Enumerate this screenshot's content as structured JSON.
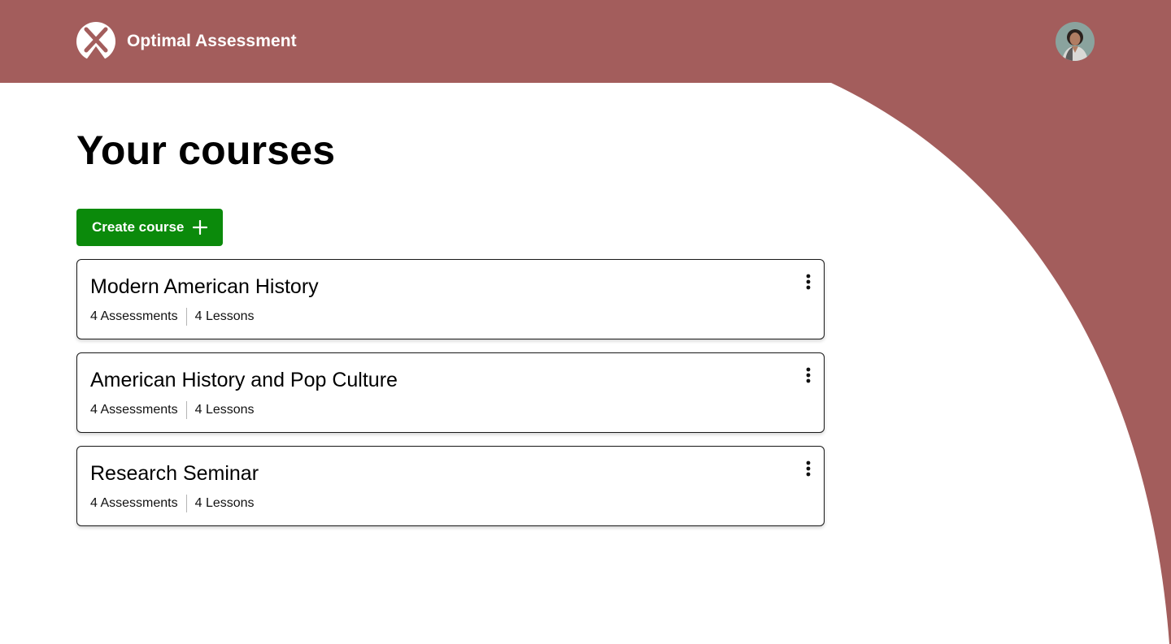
{
  "app": {
    "name": "Optimal Assessment"
  },
  "colors": {
    "brand": "#a35d5c",
    "accent_button": "#0b8a0b",
    "background": "#ffffff"
  },
  "header": {
    "logo_icon": "crossed-pencils-logo-icon",
    "avatar_icon": "user-avatar"
  },
  "main": {
    "title": "Your courses",
    "create_button": {
      "label": "Create course",
      "icon": "plus-icon"
    },
    "courses": [
      {
        "title": "Modern American History",
        "assessments": "4 Assessments",
        "lessons": "4 Lessons",
        "menu_icon": "kebab-menu-icon"
      },
      {
        "title": "American History and Pop Culture",
        "assessments": "4 Assessments",
        "lessons": "4 Lessons",
        "menu_icon": "kebab-menu-icon"
      },
      {
        "title": "Research Seminar",
        "assessments": "4 Assessments",
        "lessons": "4 Lessons",
        "menu_icon": "kebab-menu-icon"
      }
    ]
  }
}
